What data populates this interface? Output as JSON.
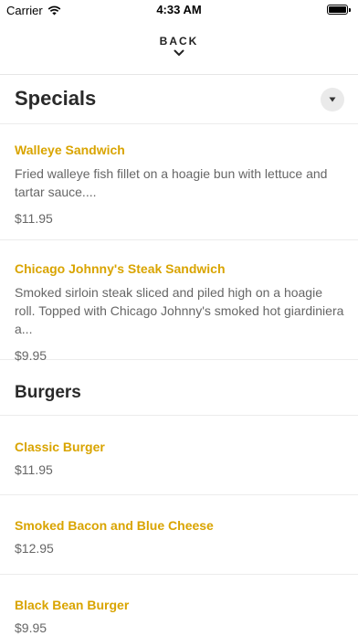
{
  "status": {
    "carrier": "Carrier",
    "time": "4:33 AM"
  },
  "nav": {
    "back_label": "BACK"
  },
  "sections": [
    {
      "title": "Specials",
      "items": [
        {
          "name": "Walleye Sandwich",
          "description": "Fried walleye fish fillet on a hoagie bun with lettuce and tartar sauce....",
          "price": "$11.95"
        },
        {
          "name": "Chicago Johnny's Steak Sandwich",
          "description": "Smoked sirloin steak sliced and piled high on a hoagie roll. Topped with Chicago Johnny's smoked hot giardiniera a...",
          "price": "$9.95"
        }
      ]
    },
    {
      "title": "Burgers",
      "items": [
        {
          "name": "Classic Burger",
          "price": "$11.95"
        },
        {
          "name": "Smoked Bacon and Blue Cheese",
          "price": "$12.95"
        },
        {
          "name": "Black Bean Burger",
          "price": "$9.95"
        }
      ]
    }
  ]
}
